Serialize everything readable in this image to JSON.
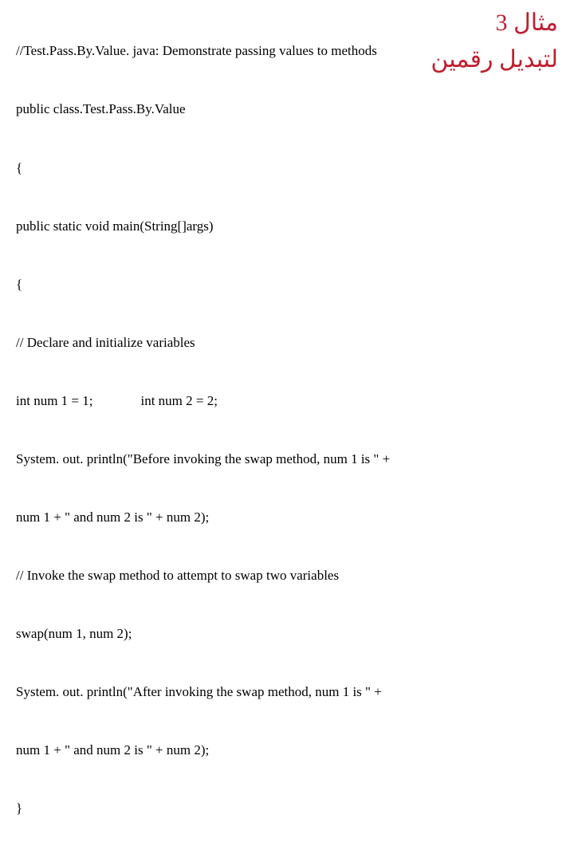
{
  "title": {
    "line1": "مثال 3",
    "line2": "لتبديل رقمين"
  },
  "code": {
    "l01": "//Test.Pass.By.Value. java: Demonstrate passing values to methods",
    "l02": "public class.Test.Pass.By.Value",
    "l03": "{",
    "l04": "public static void main(String[]args)",
    "l05": "{",
    "l06": "// Declare and initialize variables",
    "l07a": "int num 1 = 1;",
    "l07b": "int num 2 = 2;",
    "l08": "System. out. println(\"Before invoking the swap method, num 1 is \" +",
    "l09": "num 1 + \" and num 2 is \" + num 2);",
    "l10": "// Invoke the swap method to attempt to swap two variables",
    "l11": "swap(num 1, num 2);",
    "l12": "System. out. println(\"After invoking the swap method, num 1 is \" +",
    "l13": "num 1 + \" and num 2 is \" + num 2);",
    "l14": "}"
  }
}
